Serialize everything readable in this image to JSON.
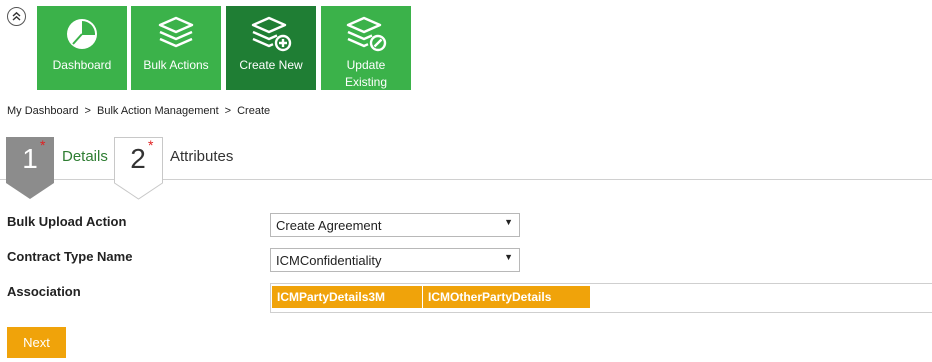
{
  "toolbar": {
    "tiles": [
      {
        "label": "Dashboard",
        "icon": "pie-chart-icon"
      },
      {
        "label": "Bulk Actions",
        "icon": "layers-icon"
      },
      {
        "label": "Create New",
        "icon": "layers-add-icon",
        "active": true
      },
      {
        "label": "Update Existing",
        "icon": "layers-edit-icon"
      }
    ]
  },
  "breadcrumb": {
    "items": [
      "My Dashboard",
      "Bulk Action Management",
      "Create"
    ],
    "separator": ">"
  },
  "steps": [
    {
      "number": "1",
      "label": "Details",
      "required_mark": "*"
    },
    {
      "number": "2",
      "label": "Attributes",
      "required_mark": "*"
    }
  ],
  "form": {
    "bulk_upload_action": {
      "label": "Bulk Upload Action",
      "value": "Create Agreement"
    },
    "contract_type_name": {
      "label": "Contract Type Name",
      "value": "ICMConfidentiality"
    },
    "association": {
      "label": "Association",
      "tags": [
        "ICMPartyDetails3M",
        "ICMOtherPartyDetails"
      ]
    }
  },
  "actions": {
    "next_label": "Next"
  },
  "colors": {
    "tile_green": "#3bb24a",
    "tile_active_green": "#1f7e34",
    "accent_orange": "#f0a30a",
    "step_active_gray": "#8c8c8c",
    "required_red": "#e02020"
  }
}
